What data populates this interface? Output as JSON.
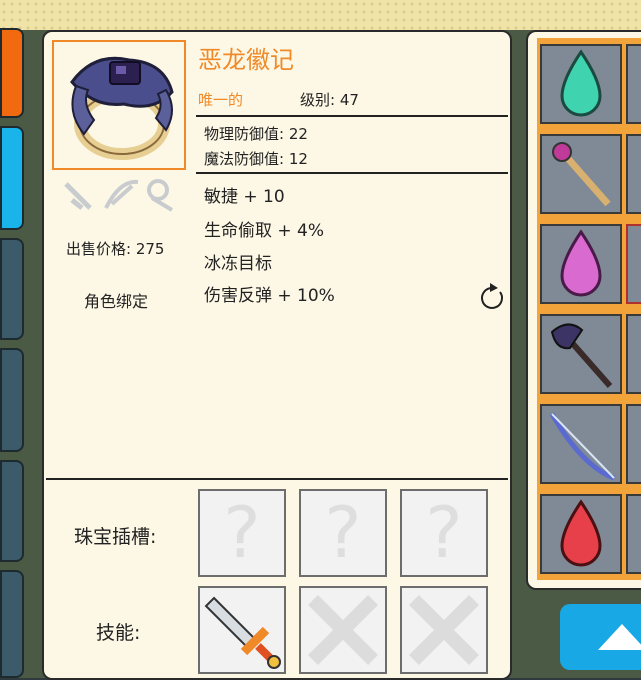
{
  "item": {
    "name": "恶龙徽记",
    "rarity": "唯一的",
    "level_label": "级别:",
    "level_value": "47",
    "physical_defense": "物理防御值: 22",
    "magic_defense": "魔法防御值: 12",
    "sell_price": "出售价格: 275",
    "binding": "角色绑定",
    "bonuses": [
      {
        "text": "敏捷 + 10",
        "color": "#222222"
      },
      {
        "text": "生命偷取 + 4%",
        "color": "#222222"
      },
      {
        "text": "冰冻目标",
        "color": "#f08a28"
      },
      {
        "text": "伤害反弹 + 10%",
        "color": "#f08a28"
      }
    ]
  },
  "sockets": {
    "label": "珠宝插槽:",
    "slots": [
      "?",
      "?",
      "?"
    ]
  },
  "skills": {
    "label": "技能:",
    "slots": [
      "flame-sword-icon",
      "locked-x-icon",
      "locked-x-icon"
    ]
  },
  "inventory": [
    "teal-gem-icon",
    "golden-staff-icon",
    "pink-gem-icon",
    "dark-axe-icon",
    "ice-bow-icon",
    "red-gem-icon"
  ],
  "colors": {
    "accent": "#f08a28",
    "panel": "#fdf8e6",
    "tab_blue": "#18b4ea",
    "tab_orange": "#f26a10"
  }
}
